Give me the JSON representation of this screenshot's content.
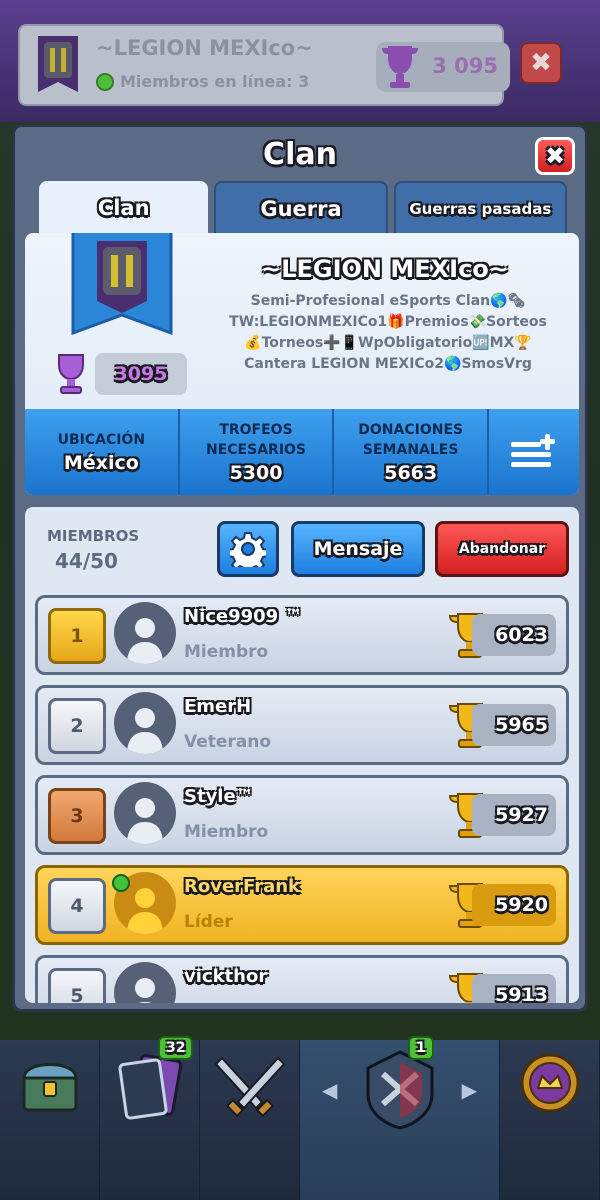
{
  "top_bar": {
    "clan_name": "~LEGION MEXIco~",
    "online_text": "Miembros en línea: 3",
    "trophies": "3 095",
    "close_label": "✖"
  },
  "panel": {
    "title": "Clan",
    "close_label": "✖",
    "tabs": [
      {
        "label": "Clan",
        "active": true
      },
      {
        "label": "Guerra",
        "active": false
      },
      {
        "label": "Guerras pasadas",
        "active": false
      }
    ]
  },
  "clan_info": {
    "name": "~LEGION MEXIco~",
    "description": [
      "Semi-Profesional eSports Clan🌎🗞",
      "TW:LEGIONMEXICo1🎁Premios💸Sorteos",
      "💰Torneos➕📱WpObligatorio🆙MX🏆",
      "Cantera LEGION MEXICo2🌎SmosVrg"
    ],
    "trophies": "3095",
    "stats": [
      {
        "label": "UBICACIÓN",
        "value": "México"
      },
      {
        "label": "TROFEOS NECESARIOS",
        "value": "5300"
      },
      {
        "label": "DONACIONES SEMANALES",
        "value": "5663"
      }
    ]
  },
  "members": {
    "count_label": "MIEMBROS",
    "count": "44/50",
    "message_label": "Mensaje",
    "leave_label": "Abandonar",
    "list": [
      {
        "rank": "1",
        "name": "Nice9909 ™",
        "role": "Miembro",
        "trophies": "6023"
      },
      {
        "rank": "2",
        "name": "EmerH",
        "role": "Veterano",
        "trophies": "5965"
      },
      {
        "rank": "3",
        "name": "Style™",
        "role": "Miembro",
        "trophies": "5927"
      },
      {
        "rank": "4",
        "name": "RoverFrank",
        "role": "Líder",
        "trophies": "5920"
      },
      {
        "rank": "5",
        "name": "vickthor",
        "role": "",
        "trophies": "5913"
      }
    ]
  },
  "bottom_nav": {
    "cards_badge": "32",
    "clan_badge": "1"
  },
  "colors": {
    "accent_blue": "#1d7ee0",
    "danger_red": "#d32121",
    "gold": "#f0b324",
    "online_green": "#4fbf3a"
  }
}
